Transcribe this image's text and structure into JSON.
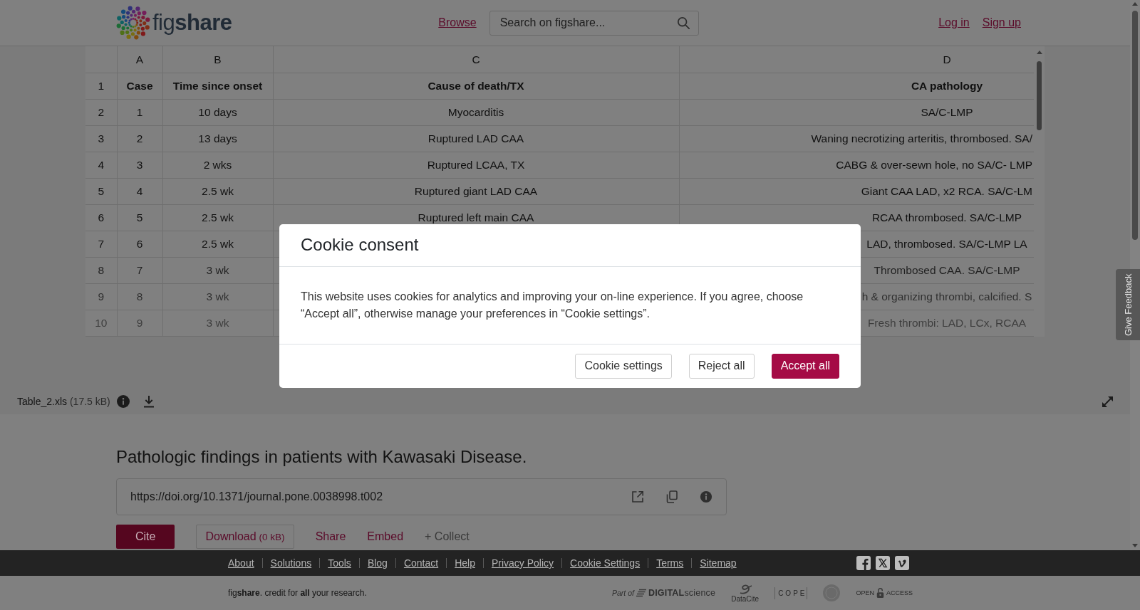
{
  "header": {
    "logo": "fig**share**",
    "nav_link": "Browse",
    "search": {
      "placeholder": "Search on figshare..."
    },
    "account_links": [
      "Log in",
      "Sign up"
    ]
  },
  "preview": {
    "columns": [
      "A",
      "B",
      "C",
      "D"
    ],
    "rows": [
      {
        "number": "1",
        "bold": true,
        "cells": [
          "Case",
          "Time since onset",
          "Cause of death/TX",
          "CA pathology"
        ]
      },
      {
        "number": "2",
        "bold": false,
        "cells": [
          "1",
          "10 days",
          "Myocarditis",
          "SA/C-LMP"
        ]
      },
      {
        "number": "3",
        "bold": false,
        "cells": [
          "2",
          "13 days",
          "Ruptured LAD CAA",
          "Waning necrotizing arteritis, thrombosed. SA/"
        ]
      },
      {
        "number": "4",
        "bold": false,
        "cells": [
          "3",
          "2 wks",
          "Ruptured LCAA, TX",
          "CABG & over-sewn hole, no SA/C- LMP"
        ]
      },
      {
        "number": "5",
        "bold": false,
        "cells": [
          "4",
          "2.5 wk",
          "Ruptured giant LAD CAA",
          "Giant CAA LAD, x2 RCA. SA/C-LM"
        ]
      },
      {
        "number": "6",
        "bold": false,
        "cells": [
          "5",
          "2.5 wk",
          "Ruptured left main CAA",
          "RCAA thrombosed. SA/C-LMP"
        ]
      },
      {
        "number": "7",
        "bold": false,
        "cells": [
          "6",
          "2.5 wk",
          null,
          "LAD, thrombosed. SA/C-LMP LA"
        ]
      },
      {
        "number": "8",
        "bold": false,
        "cells": [
          "7",
          "3 wk",
          null,
          "Thrombosed CAA. SA/C-LMP"
        ]
      },
      {
        "number": "9",
        "bold": false,
        "cells": [
          "8",
          "3 wk",
          null,
          "h & organizing thrombi, calcified. S"
        ]
      },
      {
        "number": "10",
        "bold": false,
        "cells": [
          "9",
          "3 wk",
          null,
          "Fresh thrombi: LAD, LCx, RCAA"
        ]
      }
    ],
    "file": {
      "name": "Table_2.xls",
      "size": "(17.5 kB)"
    }
  },
  "item": {
    "title": "Pathologic findings in patients with Kawasaki Disease.",
    "doi": "https://doi.org/10.1371/journal.pone.0038998.t002",
    "actions": [
      {
        "kind": "primary",
        "label": "Cite"
      },
      {
        "kind": "outlined",
        "label": "Download",
        "note": "(0 kB)"
      },
      {
        "kind": "link",
        "label": "Share"
      },
      {
        "kind": "link",
        "label": "Embed"
      },
      {
        "kind": "muted",
        "label": "+ Collect"
      }
    ]
  },
  "feedback_tab": "Give Feedback",
  "footer": {
    "links": [
      "About",
      "Solutions",
      "Tools",
      "Blog",
      "Contact",
      "Help",
      "Privacy Policy",
      "Cookie Settings",
      "Terms",
      "Sitemap"
    ],
    "tagline": "fig**share**. credit for **all** your research.",
    "partners": [
      {
        "kind": "digital_science",
        "prefix": "Part of",
        "name": "**DIGITAL**science"
      },
      {
        "kind": "datacite",
        "name": "DataCite"
      },
      {
        "kind": "cope",
        "name": "COPE"
      },
      {
        "kind": "seal"
      },
      {
        "kind": "open_access",
        "prefix": "OPEN",
        "name": "ACCESS"
      }
    ]
  },
  "cookie_dialog": {
    "title": "Cookie consent",
    "message": "This website uses cookies for analytics and improving your on-line experience. If you agree, choose “Accept all”, otherwise manage your preferences in “Cookie settings”.",
    "buttons": [
      {
        "kind": "secondary",
        "label": "Cookie settings"
      },
      {
        "kind": "secondary",
        "label": "Reject all"
      },
      {
        "kind": "primary",
        "label": "Accept all"
      }
    ]
  }
}
